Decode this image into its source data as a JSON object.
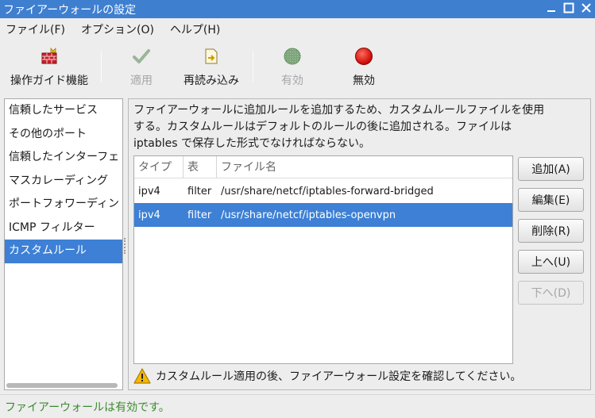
{
  "window": {
    "title": "ファイアーウォールの設定",
    "controls": [
      "minimize-icon",
      "maximize-icon",
      "close-icon"
    ]
  },
  "menubar": {
    "items": [
      {
        "label": "ファイル(F)"
      },
      {
        "label": "オプション(O)"
      },
      {
        "label": "ヘルプ(H)"
      }
    ]
  },
  "toolbar": {
    "wizard": {
      "label": "操作ガイド機能",
      "icon": "firewall-wizard-icon",
      "enabled": true
    },
    "apply": {
      "label": "適用",
      "icon": "check-icon",
      "enabled": false
    },
    "reload": {
      "label": "再読み込み",
      "icon": "reload-icon",
      "enabled": true
    },
    "enable": {
      "label": "有効",
      "icon": "green-circle-icon",
      "enabled": false
    },
    "disable": {
      "label": "無効",
      "icon": "red-circle-icon",
      "enabled": true
    }
  },
  "sidebar": {
    "items": [
      {
        "label": "信頼したサービス",
        "selected": false
      },
      {
        "label": "その他のポート",
        "selected": false
      },
      {
        "label": "信頼したインターフェ",
        "selected": false
      },
      {
        "label": "マスカレーディング",
        "selected": false
      },
      {
        "label": "ポートフォワーディン",
        "selected": false
      },
      {
        "label": "ICMP フィルター",
        "selected": false
      },
      {
        "label": "カスタムルール",
        "selected": true
      }
    ]
  },
  "main": {
    "description": "ファイアーウォールに追加ルールを追加するため、カスタムルールファイルを使用する。カスタムルールはデフォルトのルールの後に追加される。ファイルは iptables で保存した形式でなければならない。",
    "description_lines": [
      "ファイアーウォールに追加ルールを追加するため、カスタムルールファイルを使用",
      "する。カスタムルールはデフォルトのルールの後に追加される。ファイルは",
      "iptables で保存した形式でなければならない。"
    ],
    "table": {
      "columns": [
        "タイプ",
        "表",
        "ファイル名"
      ],
      "rows": [
        {
          "type": "ipv4",
          "table": "filter",
          "file": "/usr/share/netcf/iptables-forward-bridged",
          "selected": false
        },
        {
          "type": "ipv4",
          "table": "filter",
          "file": "/usr/share/netcf/iptables-openvpn",
          "selected": true
        }
      ]
    },
    "buttons": {
      "add": {
        "label": "追加(A)",
        "enabled": true
      },
      "edit": {
        "label": "編集(E)",
        "enabled": true
      },
      "remove": {
        "label": "削除(R)",
        "enabled": true
      },
      "up": {
        "label": "上へ(U)",
        "enabled": true
      },
      "down": {
        "label": "下へ(D)",
        "enabled": false
      }
    },
    "warning": {
      "icon": "warning-icon",
      "text": "カスタムルール適用の後、ファイアーウォール設定を確認してください。"
    }
  },
  "status": {
    "text": "ファイアーウォールは有効です。"
  },
  "colors": {
    "titlebar": "#3f7fd0",
    "selection": "#3d80d5",
    "status_text": "#3a8c2c",
    "disabled_text": "#a6a6a6"
  }
}
